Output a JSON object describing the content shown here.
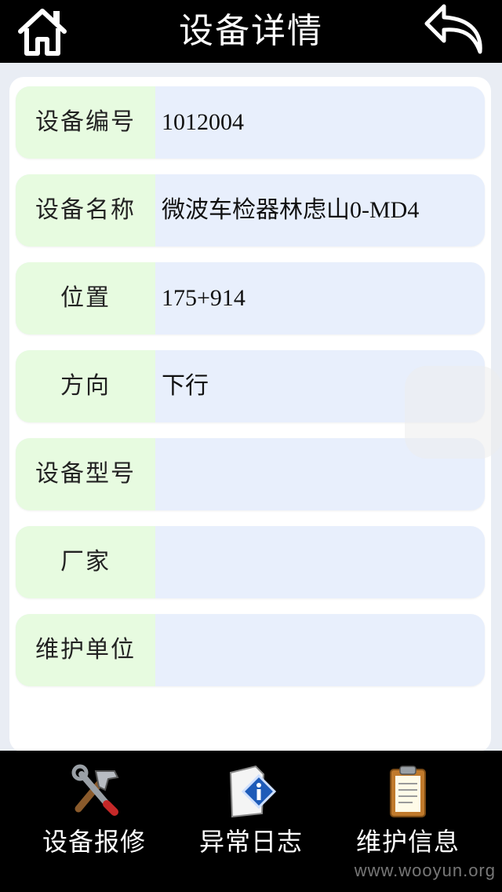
{
  "header": {
    "title": "设备详情",
    "home_icon": "home-icon",
    "back_icon": "back-arrow-icon"
  },
  "details": {
    "rows": [
      {
        "label": "设备编号",
        "value": "1012004"
      },
      {
        "label": "设备名称",
        "value": "微波车检器林虑山0-MD4"
      },
      {
        "label": "位置",
        "value": "175+914"
      },
      {
        "label": "方向",
        "value": "下行"
      },
      {
        "label": "设备型号",
        "value": ""
      },
      {
        "label": "厂家",
        "value": ""
      },
      {
        "label": "维护单位",
        "value": ""
      }
    ]
  },
  "tabs": [
    {
      "label": "设备报修",
      "icon": "tools-icon"
    },
    {
      "label": "异常日志",
      "icon": "info-document-icon"
    },
    {
      "label": "维护信息",
      "icon": "clipboard-icon"
    }
  ],
  "watermark": "www.wooyun.org",
  "colors": {
    "header_bg": "#000000",
    "label_bg": "#e7fbe0",
    "value_bg": "#e8effc",
    "page_bg": "#e9edf4"
  }
}
